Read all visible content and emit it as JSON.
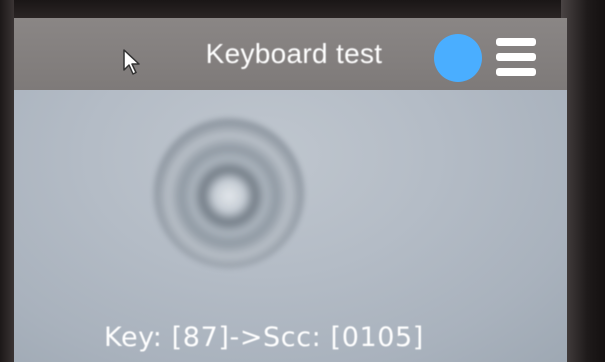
{
  "header": {
    "title": "Keyboard test",
    "status_indicator_color": "#4aaeff",
    "menu_icon": "hamburger-menu-icon",
    "pointer_icon": "mouse-pointer-icon"
  },
  "main": {
    "key_readout": "Key: [87]->Scc: [0105]"
  }
}
